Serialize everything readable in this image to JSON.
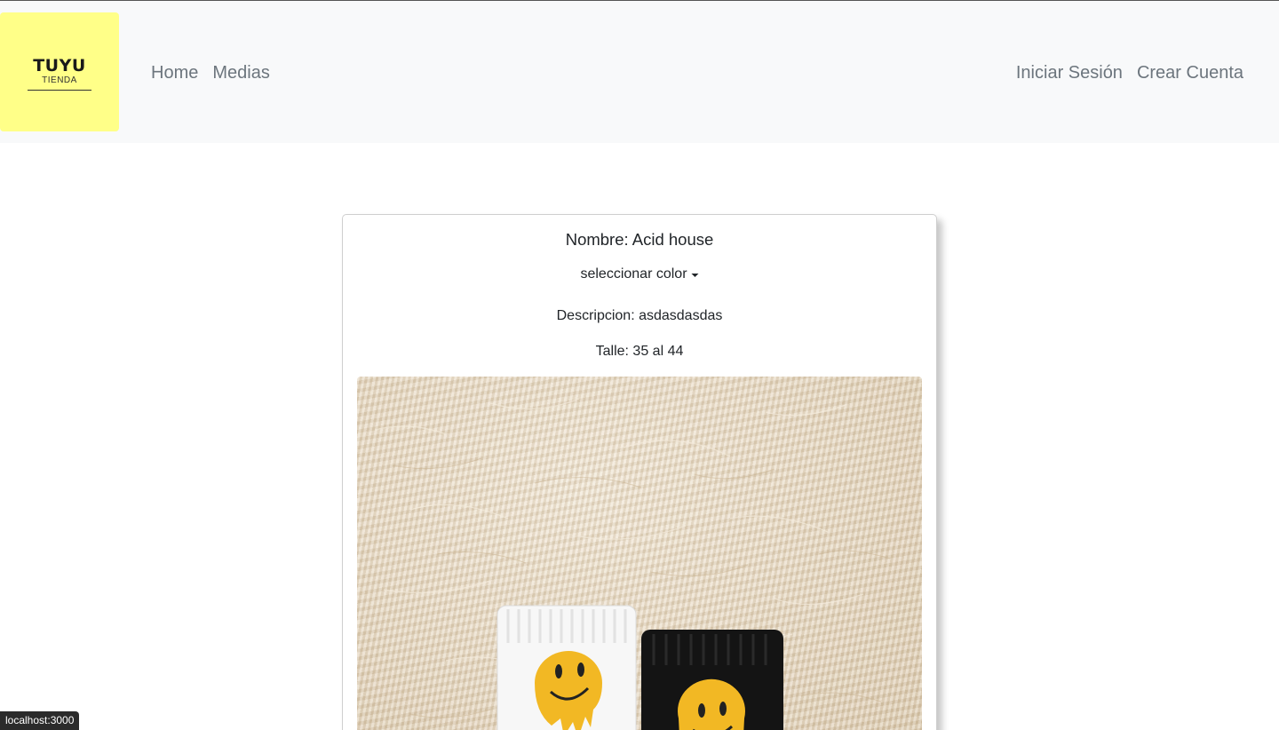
{
  "nav": {
    "logo": {
      "main": "TUYU",
      "sub": "TIENDA"
    },
    "left_links": [
      "Home",
      "Medias"
    ],
    "right_links": [
      "Iniciar Sesión",
      "Crear Cuenta"
    ]
  },
  "product": {
    "title": "Nombre: Acid house",
    "color_dropdown": "seleccionar color",
    "description": "Descripcion: asdasdasdas",
    "size": "Talle: 35 al 44",
    "image_icon": "socks-photo"
  },
  "status_bar": "localhost:3000",
  "colors": {
    "navbar_bg": "#f8f9fa",
    "logo_bg": "#ffff88",
    "nav_link": "#6c757d",
    "smiley_yellow": "#f2b824"
  }
}
